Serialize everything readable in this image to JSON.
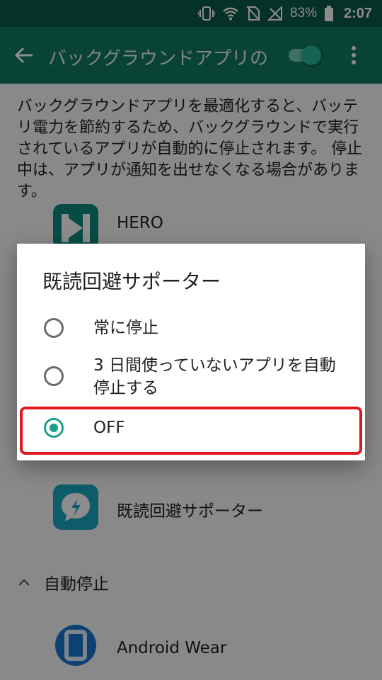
{
  "status_bar": {
    "battery_percent": "83%",
    "time": "2:07",
    "icons": [
      "vibrate-icon",
      "wifi-icon",
      "no-sim-icon",
      "signal-icon",
      "battery-icon"
    ]
  },
  "app_bar": {
    "title": "バックグラウンドアプリの最適化",
    "toggle_on": true,
    "colors": {
      "bar": "#0f7a61",
      "status": "#0b5a48",
      "accent": "#1aa18a"
    }
  },
  "description": "バックグラウンドアプリを最適化すると、バッテリ電力を節約するため、バックグラウンドで実行されているアプリが自動的に停止されます。 停止中は、アプリが通知を出せなくなる場合があります。",
  "apps": {
    "hero": {
      "label": "HERO"
    },
    "kidoku": {
      "label": "既読回避サポーター"
    },
    "section_label": "自動停止",
    "android_wear": {
      "label": "Android Wear"
    }
  },
  "dialog": {
    "title": "既読回避サポーター",
    "options": [
      {
        "label": "常に停止",
        "checked": false
      },
      {
        "label": "3 日間使っていないアプリを自動停止する",
        "checked": false
      },
      {
        "label": "OFF",
        "checked": true
      }
    ],
    "highlight_color": "#e0191f"
  }
}
